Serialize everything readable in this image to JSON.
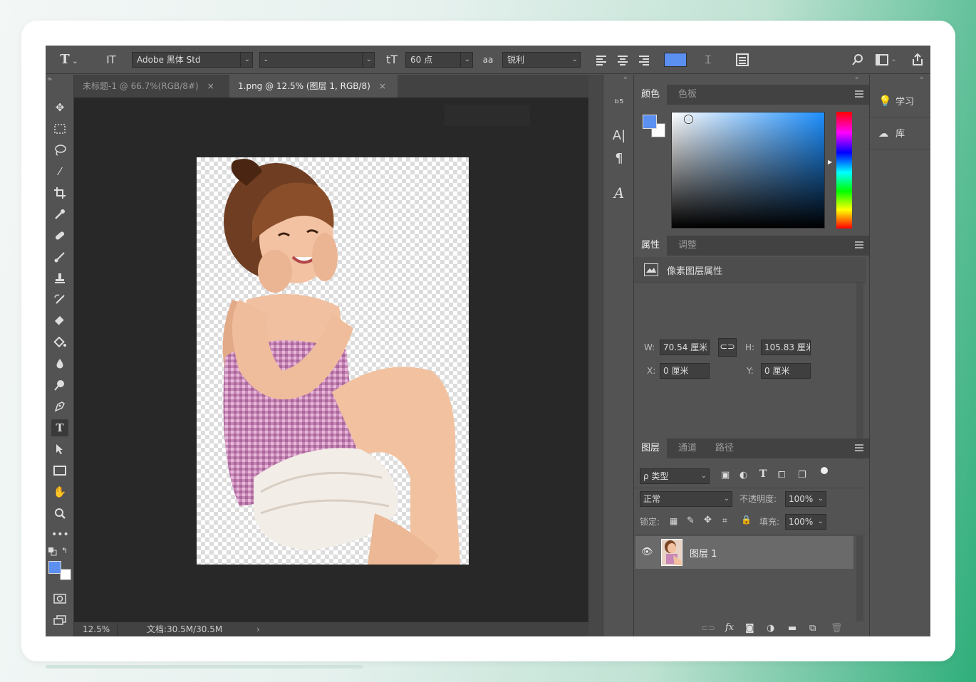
{
  "options_bar": {
    "type_tool_icon": "T",
    "orient_icon": "IT",
    "font_family": "Adobe 黑体 Std",
    "font_style": "-",
    "size_icon": "tT",
    "font_size": "60 点",
    "aa_icon": "aa",
    "anti_alias": "锐利",
    "text_color": "#5b8ff0"
  },
  "tabs": [
    {
      "label": "未标题-1 @ 66.7%(RGB/8#)",
      "close": "×"
    },
    {
      "label": "1.png @ 12.5% (图层 1, RGB/8)",
      "close": "×"
    }
  ],
  "status": {
    "zoom": "12.5%",
    "doc_size": "文档:30.5M/30.5M",
    "arrow": "›"
  },
  "color_panel": {
    "tabs": [
      "颜色",
      "色板"
    ],
    "foreground": "#5b8ff0",
    "background": "#ffffff",
    "base_hue": "#1e90ff"
  },
  "properties_panel": {
    "tabs": [
      "属性",
      "调整"
    ],
    "title": "像素图层属性",
    "w_label": "W:",
    "w_value": "70.54 厘米",
    "h_label": "H:",
    "h_value": "105.83 厘米",
    "x_label": "X:",
    "x_value": "0 厘米",
    "y_label": "Y:",
    "y_value": "0 厘米"
  },
  "layers_panel": {
    "tabs": [
      "图层",
      "通道",
      "路径"
    ],
    "filter_label": "ρ 类型",
    "blend_mode": "正常",
    "opacity_label": "不透明度:",
    "opacity_value": "100%",
    "lock_label": "锁定:",
    "fill_label": "填充:",
    "fill_value": "100%",
    "layers": [
      {
        "name": "图层 1",
        "visible": true
      }
    ]
  },
  "right_dock": [
    {
      "label": "学习",
      "icon": "lightbulb-icon"
    },
    {
      "label": "库",
      "icon": "creative-cloud-icon"
    }
  ]
}
